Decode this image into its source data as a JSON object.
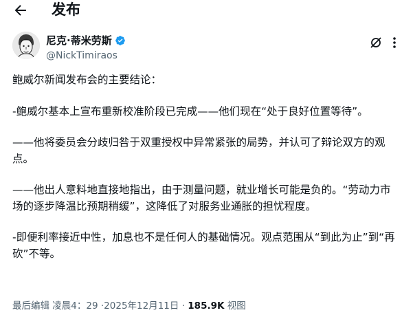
{
  "header": {
    "title": "发布",
    "back_icon": "arrow-left-icon"
  },
  "author": {
    "display_name": "尼克·蒂米劳斯",
    "handle": "@NickTimiraos",
    "verified_color": "#1d9bf0"
  },
  "tweet": {
    "paragraphs": [
      "鲍威尔新闻发布会的主要结论：",
      "-鲍威尔基本上宣布重新校准阶段已完成——他们现在“处于良好位置等待”。",
      "——他将委员会分歧归咎于双重授权中异常紧张的局势，并认可了辩论双方的观点。",
      "——他出人意料地直接地指出，由于测量问题，就业增长可能是负的。“劳动力市场的逐步降温比预期稍缓”，这降低了对服务业通胀的担忧程度。",
      "-即便利率接近中性，加息也不是任何人的基础情况。观点范围从“到此为止”到“再砍”不等。"
    ]
  },
  "meta": {
    "edited_label": "最后编辑",
    "time": "凌晨4：29",
    "date": "2025年12月11日",
    "views_count": "185.9K",
    "views_label": "视图"
  }
}
